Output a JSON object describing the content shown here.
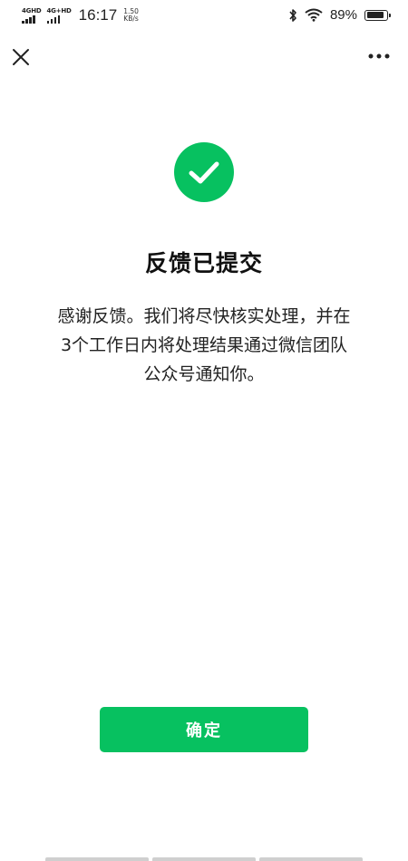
{
  "status_bar": {
    "network_1": "4GHD",
    "network_2": "4G+HD",
    "time": "16:17",
    "speed_value": "1.50",
    "speed_unit": "KB/s",
    "battery_percent": "89%",
    "battery_level": 0.89,
    "icons": [
      "signal-icon",
      "bluetooth-icon",
      "wifi-icon",
      "battery-icon"
    ]
  },
  "nav": {
    "close_icon": "close-icon",
    "more_icon": "more-dots-icon"
  },
  "result": {
    "icon": "checkmark-circle-icon",
    "icon_color": "#07c160",
    "title": "反馈已提交",
    "message_lines": [
      "感谢反馈。我们将尽快核实处理，并在",
      "3个工作日内将处理结果通过微信团队",
      "公众号通知你。"
    ]
  },
  "actions": {
    "confirm_label": "确定",
    "confirm_color": "#07c160"
  }
}
